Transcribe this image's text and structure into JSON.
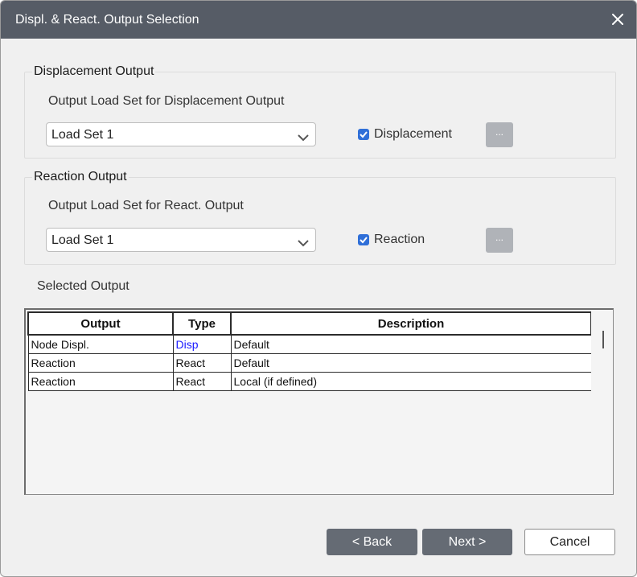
{
  "window": {
    "title": "Displ. & React. Output Selection",
    "close_icon": "close-icon"
  },
  "displacement": {
    "group_label": "Displacement Output",
    "load_set_label": "Output Load Set for Displacement Output",
    "load_set_value": "Load Set 1",
    "checkbox_label": "Displacement",
    "checkbox_checked": true,
    "more_button": "..."
  },
  "reaction": {
    "group_label": "Reaction Output",
    "load_set_label": "Output Load Set for React. Output",
    "load_set_value": "Load Set 1",
    "checkbox_label": "Reaction",
    "checkbox_checked": true,
    "more_button": "..."
  },
  "selected": {
    "label": "Selected Output",
    "columns": [
      "Output",
      "Type",
      "Description"
    ],
    "rows": [
      {
        "output": "Node Displ.",
        "type": "Disp",
        "description": "Default"
      },
      {
        "output": "Reaction",
        "type": "React",
        "description": "Default"
      },
      {
        "output": "Reaction",
        "type": "React",
        "description": "Local (if defined)"
      }
    ]
  },
  "footer": {
    "back": "< Back",
    "next": "Next >",
    "cancel": "Cancel"
  },
  "colors": {
    "titlebar": "#565c66",
    "checkbox": "#2f6fd8",
    "link_type": "#1a1aff",
    "primary_button": "#656b74"
  }
}
